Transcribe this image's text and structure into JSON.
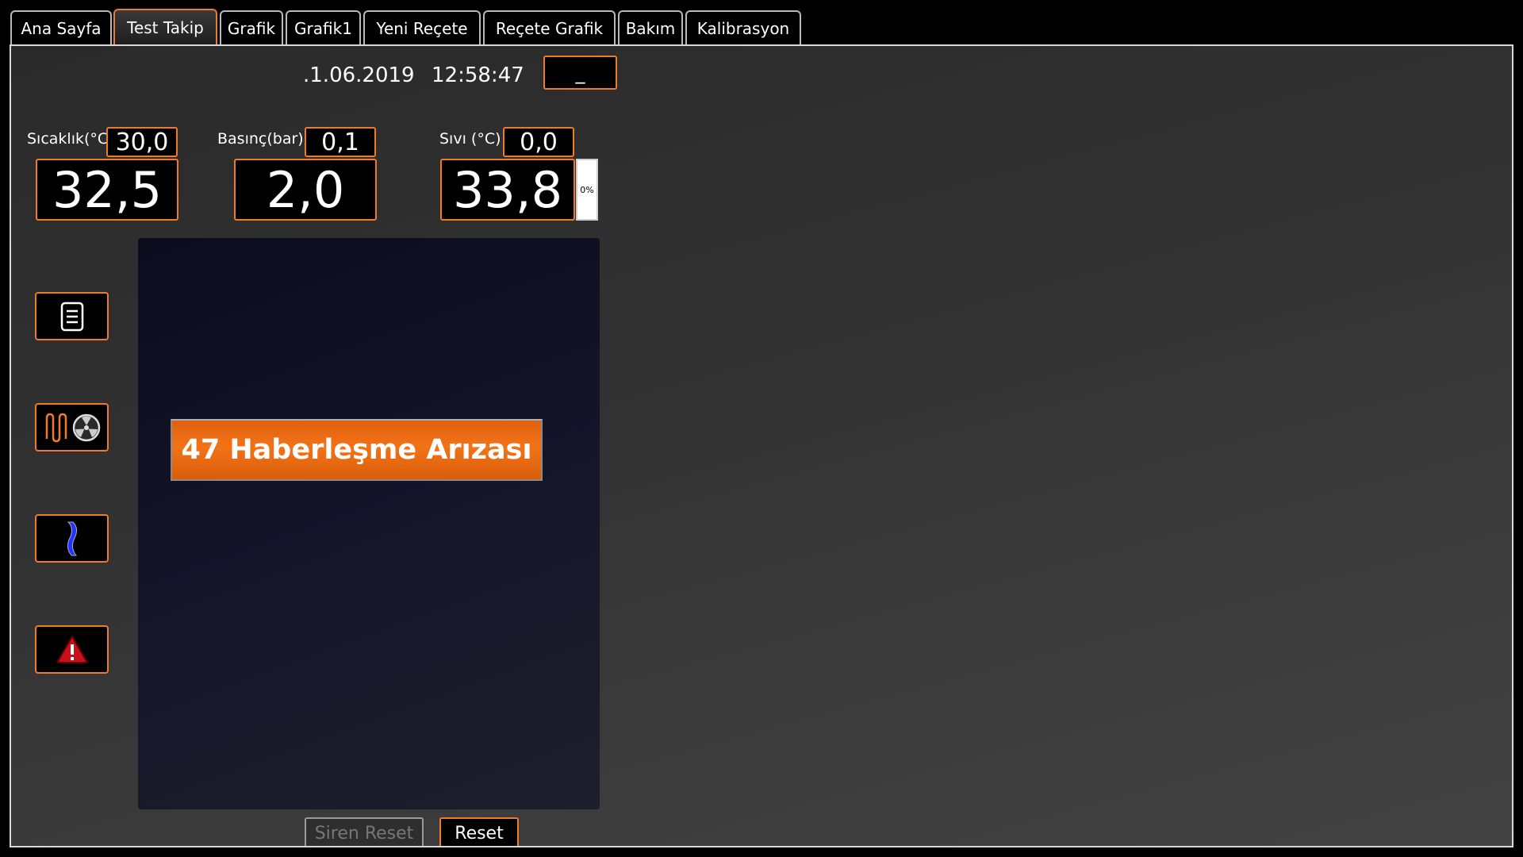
{
  "tabs": [
    "Ana Sayfa",
    "Test Takip",
    "Grafik",
    "Grafik1",
    "Yeni Reçete",
    "Reçete Grafik",
    "Bakım",
    "Kalibrasyon"
  ],
  "active_tab": "Test Takip",
  "header": {
    "date": ".1.06.2019",
    "time": "12:58:47",
    "minimize_label": "_"
  },
  "readings": {
    "temperature": {
      "label": "Sıcaklık(°C",
      "setpoint": "30,0",
      "value": "32,5"
    },
    "pressure": {
      "label": "Basınç(bar)",
      "setpoint": "0,1",
      "value": "2,0"
    },
    "liquid": {
      "label": "Sıvı (°C)",
      "setpoint": "0,0",
      "value": "33,8",
      "level_text": "0%",
      "level_fraction": 0
    }
  },
  "side_buttons": [
    {
      "icon": "document-icon"
    },
    {
      "icon": "heater-fan-icon"
    },
    {
      "icon": "liquid-icon"
    },
    {
      "icon": "warning-icon"
    }
  ],
  "alarm": {
    "message": "47 Haberleşme Arızası"
  },
  "buttons": {
    "siren_reset": "Siren Reset",
    "reset": "Reset"
  },
  "colors": {
    "accent": "#f07a2a",
    "alarm": "#f27316"
  }
}
